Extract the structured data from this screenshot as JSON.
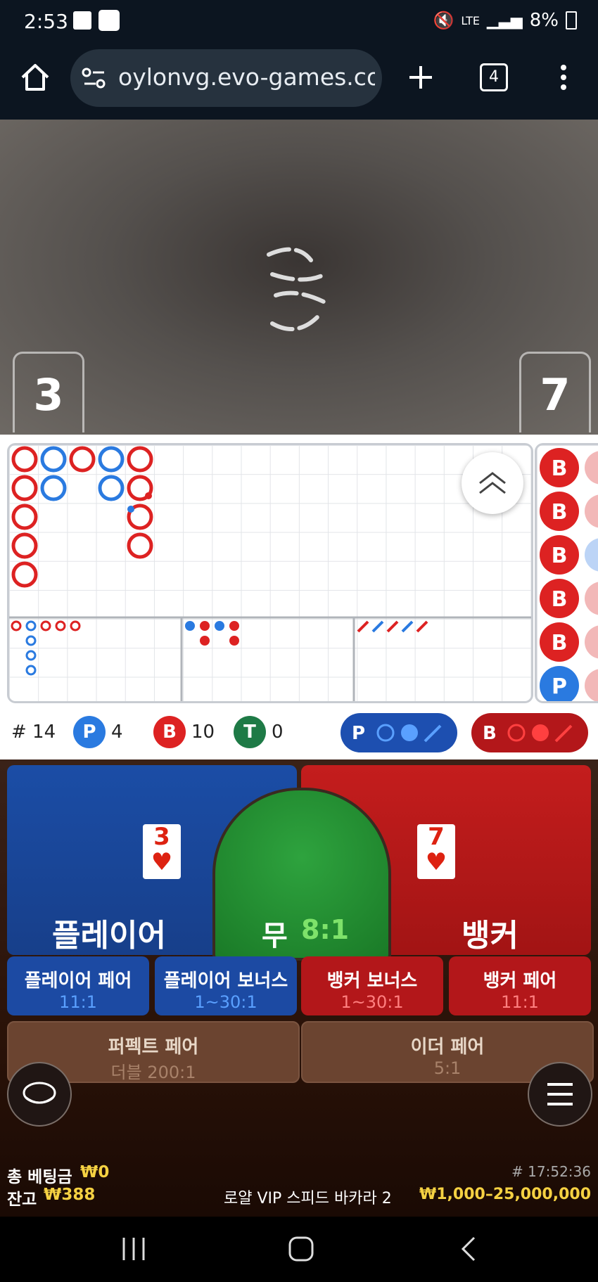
{
  "status_bar": {
    "time": "2:53",
    "signal_label": "LTE",
    "battery": "8%"
  },
  "browser": {
    "url": "oylonvg.evo-games.com",
    "tab_count": "4"
  },
  "video": {
    "player_score": "3",
    "banker_score": "7"
  },
  "stats": {
    "hands_label": "# 14",
    "player_label": "P",
    "player_count": "4",
    "banker_label": "B",
    "banker_count": "10",
    "tie_label": "T",
    "tie_count": "0",
    "player_predict_label": "P",
    "banker_predict_label": "B"
  },
  "bead_road": [
    "B",
    "B",
    "B",
    "B",
    "B",
    "P"
  ],
  "bets": {
    "player": {
      "label": "플레이어",
      "card": "3"
    },
    "tie": {
      "label": "무",
      "odds": "8:1"
    },
    "banker": {
      "label": "뱅커",
      "card": "7"
    },
    "side": [
      {
        "label": "플레이어 페어",
        "odds": "11:1"
      },
      {
        "label": "플레이어 보너스",
        "odds": "1~30:1"
      },
      {
        "label": "뱅커 보너스",
        "odds": "1~30:1"
      },
      {
        "label": "뱅커 페어",
        "odds": "11:1"
      }
    ],
    "perfect_pair": {
      "label": "퍼펙트 페어",
      "odds": "더블 200:1"
    },
    "either_pair": {
      "label": "이더 페어",
      "odds": "5:1"
    }
  },
  "footer": {
    "total_bet_label": "총 베팅금",
    "total_bet": "₩0",
    "balance_label": "잔고",
    "balance": "₩388",
    "round_id": "# 17:52:36",
    "table_name": "로얄 VIP 스피드 바카라 2",
    "limits": "₩1,000–25,000,000"
  },
  "colors": {
    "player": "#1e5bc6",
    "banker": "#c81d1d",
    "tie": "#1e7a2e",
    "accent": "#f5d142"
  }
}
